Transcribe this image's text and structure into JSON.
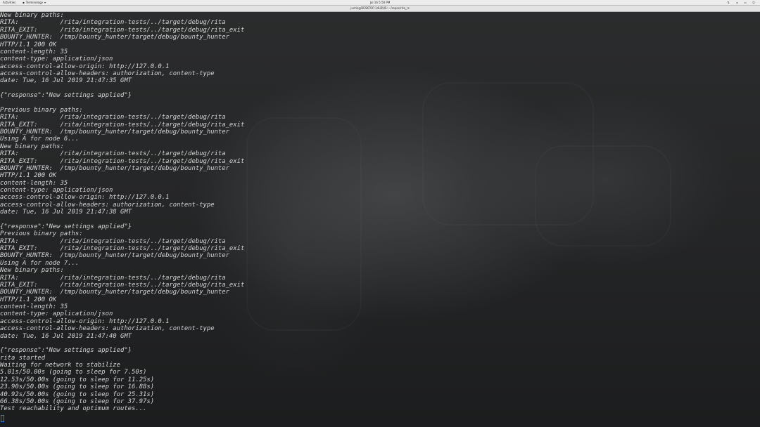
{
  "topbar": {
    "activities": "Activities",
    "app_name": "Terminology",
    "clock": "Jul 16  5:50 PM",
    "tray_icons": [
      "network-icon",
      "volume-icon",
      "battery-icon",
      "power-icon"
    ]
  },
  "window": {
    "title": "justin@DESKTOP-14LBVIS: ~/repos/rita_rs"
  },
  "terminal": {
    "cursor_color": "#2d7be0",
    "text_color": "#d6d6d6",
    "lines": [
      "New binary paths:",
      "RITA:           /rita/integration-tests/../target/debug/rita",
      "RITA_EXIT:      /rita/integration-tests/../target/debug/rita_exit",
      "BOUNTY_HUNTER:  /tmp/bounty_hunter/target/debug/bounty_hunter",
      "HTTP/1.1 200 OK",
      "content-length: 35",
      "content-type: application/json",
      "access-control-allow-origin: http://127.0.0.1",
      "access-control-allow-headers: authorization, content-type",
      "date: Tue, 16 Jul 2019 21:47:35 GMT",
      "",
      "{\"response\":\"New settings applied\"}",
      "",
      "Previous binary paths:",
      "RITA:           /rita/integration-tests/../target/debug/rita",
      "RITA_EXIT:      /rita/integration-tests/../target/debug/rita_exit",
      "BOUNTY_HUNTER:  /tmp/bounty_hunter/target/debug/bounty_hunter",
      "Using A for node 6...",
      "New binary paths:",
      "RITA:           /rita/integration-tests/../target/debug/rita",
      "RITA_EXIT:      /rita/integration-tests/../target/debug/rita_exit",
      "BOUNTY_HUNTER:  /tmp/bounty_hunter/target/debug/bounty_hunter",
      "HTTP/1.1 200 OK",
      "content-length: 35",
      "content-type: application/json",
      "access-control-allow-origin: http://127.0.0.1",
      "access-control-allow-headers: authorization, content-type",
      "date: Tue, 16 Jul 2019 21:47:38 GMT",
      "",
      "{\"response\":\"New settings applied\"}",
      "Previous binary paths:",
      "RITA:           /rita/integration-tests/../target/debug/rita",
      "RITA_EXIT:      /rita/integration-tests/../target/debug/rita_exit",
      "BOUNTY_HUNTER:  /tmp/bounty_hunter/target/debug/bounty_hunter",
      "Using A for node 7...",
      "New binary paths:",
      "RITA:           /rita/integration-tests/../target/debug/rita",
      "RITA_EXIT:      /rita/integration-tests/../target/debug/rita_exit",
      "BOUNTY_HUNTER:  /tmp/bounty_hunter/target/debug/bounty_hunter",
      "HTTP/1.1 200 OK",
      "content-length: 35",
      "content-type: application/json",
      "access-control-allow-origin: http://127.0.0.1",
      "access-control-allow-headers: authorization, content-type",
      "date: Tue, 16 Jul 2019 21:47:40 GMT",
      "",
      "{\"response\":\"New settings applied\"}",
      "rita started",
      "Waiting for network to stabilize",
      "5.01s/50.00s (going to sleep for 7.50s)",
      "12.53s/50.00s (going to sleep for 11.25s)",
      "23.90s/50.00s (going to sleep for 16.88s)",
      "40.92s/50.00s (going to sleep for 25.31s)",
      "66.38s/50.00s (going to sleep for 37.97s)",
      "Test reachability and optimum routes..."
    ]
  }
}
